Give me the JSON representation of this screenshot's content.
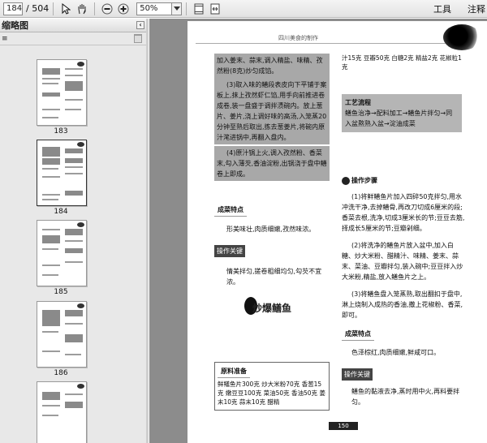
{
  "toolbar": {
    "page_current": "184",
    "page_total": "/ 504",
    "zoom": "50%",
    "tools_label": "工具",
    "comment_label": "注释"
  },
  "panel": {
    "title": "缩略图",
    "collapse": "‹",
    "thumbnails": [
      {
        "label": "183"
      },
      {
        "label": "184"
      },
      {
        "label": "185"
      },
      {
        "label": "186"
      }
    ]
  },
  "page": {
    "running_head": "四川美食的制作",
    "left_block1": "加入姜末、蒜末,调入精盐、味精、孜然粉(8克)炒匀成馅。",
    "left_block2": "(3)取入味的鳝段表皮向下平铺于案板上,抹上孜然虾仁馅,用手向前推进卷成卷,装一盘盛于调拌渍碗内。放上葱片、姜片,浇上调好味的高汤,入笼蒸20分钟至熟后取出,拣去葱姜片,将碗内原汁滗进锅中,再翻入盘内。",
    "left_block3": "(4)原汁锅上火,调入孜然粉、香菜末,勾入薄芡,香油淀粉,出锅浇于盘中鳝卷上即成。",
    "feature_head": "成菜特点",
    "feature_text": "形美味壮,肉质细嫩,孜然味浓。",
    "key_tag": "操作关键",
    "key_text": "情美拌匀,搓卷粗细均匀,勾芡不宜浓。",
    "dish_name": "炒爆鳝鱼",
    "ingredients_head": "原料准备",
    "ingredients_text": "鲜鳝鱼片300克 炒大米粉70克 香葱15克 嫩豆豆100克 菜油50克 香油50克 姜末10克 蒜末10克 醋精",
    "right_top": "汁15克 豆瓣50克 白糖2克 精盐2克 花椒粒1克",
    "process_head": "工艺流程",
    "process_text": "鳝鱼治净→配料加工→鳝鱼片拌匀→同入盆熬熟入盆→淀油成菜",
    "steps_head": "操作步骤",
    "step1": "(1)将鲜鳝鱼片加入四碎50克拌匀,用水冲洗干净,去掉鳝骨,再改刀切成6厘米的段;香菜去根,洗净,切成3厘米长的节;豆豆去筋,择成长5厘米的节;豆瓣剁细。",
    "step2": "(2)将洗净的鳝鱼片放入盆中,加入白糖、炒大米粉、醋精汁、味精、姜末、蒜末、菜油、豆瓣拌匀,装入碗中;豆豆拌入炒大米粉,精盐,放入鳝鱼片之上。",
    "step3": "(3)将鳝鱼盘入笼蒸熟,取出翻扣于盘中,淋上烧制入成热的香油,撒上花椒粉、香菜,即可。",
    "feature_head2": "成菜特点",
    "feature_text2": "色泽棕红,肉质细嫩,鲜咸可口。",
    "key_tag2": "操作关键",
    "key_text2": "鳝鱼的黏液去净,蒸时用中火,再料要拌匀。",
    "page_number": "150"
  }
}
